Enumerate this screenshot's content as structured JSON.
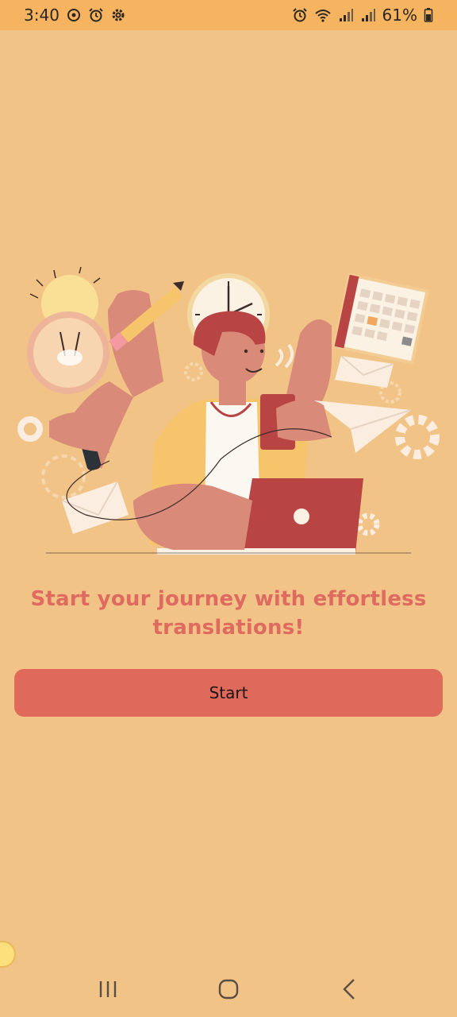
{
  "status_bar": {
    "time": "3:40",
    "battery_percent": "61%",
    "left_icons": [
      "sync-icon",
      "alarm-icon",
      "settings-icon"
    ],
    "right_icons": [
      "alarm-icon",
      "wifi-icon",
      "signal-icon",
      "signal-icon",
      "battery-icon"
    ]
  },
  "onboarding": {
    "headline": "Start your journey with effortless translations!",
    "start_label": "Start"
  },
  "colors": {
    "background": "#f2c387",
    "accent": "#df6a5c",
    "headline": "#df6a60",
    "status_bar": "#f6b460"
  },
  "nav": {
    "icons": [
      "recent-apps-icon",
      "home-icon",
      "back-icon"
    ]
  }
}
